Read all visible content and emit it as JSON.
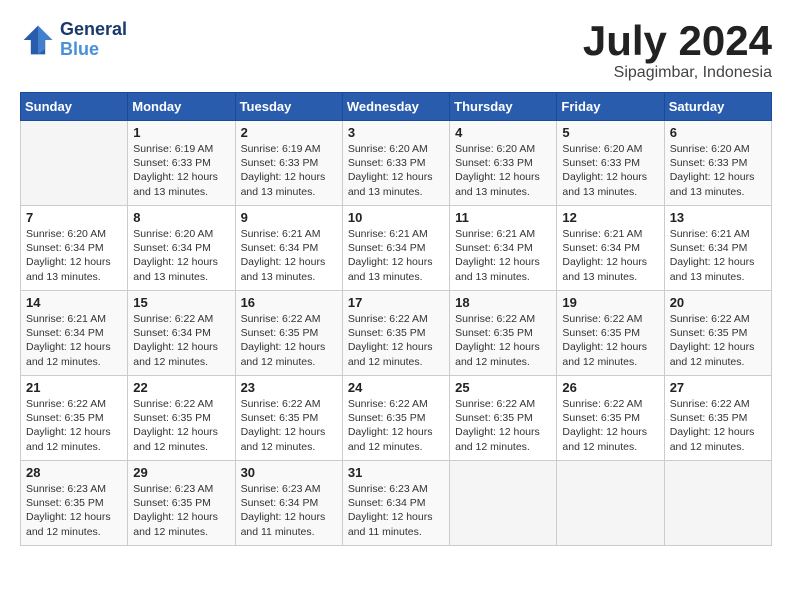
{
  "header": {
    "logo_line1": "General",
    "logo_line2": "Blue",
    "month_year": "July 2024",
    "location": "Sipagimbar, Indonesia"
  },
  "weekdays": [
    "Sunday",
    "Monday",
    "Tuesday",
    "Wednesday",
    "Thursday",
    "Friday",
    "Saturday"
  ],
  "weeks": [
    [
      {
        "day": "",
        "info": ""
      },
      {
        "day": "1",
        "info": "Sunrise: 6:19 AM\nSunset: 6:33 PM\nDaylight: 12 hours\nand 13 minutes."
      },
      {
        "day": "2",
        "info": "Sunrise: 6:19 AM\nSunset: 6:33 PM\nDaylight: 12 hours\nand 13 minutes."
      },
      {
        "day": "3",
        "info": "Sunrise: 6:20 AM\nSunset: 6:33 PM\nDaylight: 12 hours\nand 13 minutes."
      },
      {
        "day": "4",
        "info": "Sunrise: 6:20 AM\nSunset: 6:33 PM\nDaylight: 12 hours\nand 13 minutes."
      },
      {
        "day": "5",
        "info": "Sunrise: 6:20 AM\nSunset: 6:33 PM\nDaylight: 12 hours\nand 13 minutes."
      },
      {
        "day": "6",
        "info": "Sunrise: 6:20 AM\nSunset: 6:33 PM\nDaylight: 12 hours\nand 13 minutes."
      }
    ],
    [
      {
        "day": "7",
        "info": "Sunrise: 6:20 AM\nSunset: 6:34 PM\nDaylight: 12 hours\nand 13 minutes."
      },
      {
        "day": "8",
        "info": "Sunrise: 6:20 AM\nSunset: 6:34 PM\nDaylight: 12 hours\nand 13 minutes."
      },
      {
        "day": "9",
        "info": "Sunrise: 6:21 AM\nSunset: 6:34 PM\nDaylight: 12 hours\nand 13 minutes."
      },
      {
        "day": "10",
        "info": "Sunrise: 6:21 AM\nSunset: 6:34 PM\nDaylight: 12 hours\nand 13 minutes."
      },
      {
        "day": "11",
        "info": "Sunrise: 6:21 AM\nSunset: 6:34 PM\nDaylight: 12 hours\nand 13 minutes."
      },
      {
        "day": "12",
        "info": "Sunrise: 6:21 AM\nSunset: 6:34 PM\nDaylight: 12 hours\nand 13 minutes."
      },
      {
        "day": "13",
        "info": "Sunrise: 6:21 AM\nSunset: 6:34 PM\nDaylight: 12 hours\nand 13 minutes."
      }
    ],
    [
      {
        "day": "14",
        "info": "Sunrise: 6:21 AM\nSunset: 6:34 PM\nDaylight: 12 hours\nand 12 minutes."
      },
      {
        "day": "15",
        "info": "Sunrise: 6:22 AM\nSunset: 6:34 PM\nDaylight: 12 hours\nand 12 minutes."
      },
      {
        "day": "16",
        "info": "Sunrise: 6:22 AM\nSunset: 6:35 PM\nDaylight: 12 hours\nand 12 minutes."
      },
      {
        "day": "17",
        "info": "Sunrise: 6:22 AM\nSunset: 6:35 PM\nDaylight: 12 hours\nand 12 minutes."
      },
      {
        "day": "18",
        "info": "Sunrise: 6:22 AM\nSunset: 6:35 PM\nDaylight: 12 hours\nand 12 minutes."
      },
      {
        "day": "19",
        "info": "Sunrise: 6:22 AM\nSunset: 6:35 PM\nDaylight: 12 hours\nand 12 minutes."
      },
      {
        "day": "20",
        "info": "Sunrise: 6:22 AM\nSunset: 6:35 PM\nDaylight: 12 hours\nand 12 minutes."
      }
    ],
    [
      {
        "day": "21",
        "info": "Sunrise: 6:22 AM\nSunset: 6:35 PM\nDaylight: 12 hours\nand 12 minutes."
      },
      {
        "day": "22",
        "info": "Sunrise: 6:22 AM\nSunset: 6:35 PM\nDaylight: 12 hours\nand 12 minutes."
      },
      {
        "day": "23",
        "info": "Sunrise: 6:22 AM\nSunset: 6:35 PM\nDaylight: 12 hours\nand 12 minutes."
      },
      {
        "day": "24",
        "info": "Sunrise: 6:22 AM\nSunset: 6:35 PM\nDaylight: 12 hours\nand 12 minutes."
      },
      {
        "day": "25",
        "info": "Sunrise: 6:22 AM\nSunset: 6:35 PM\nDaylight: 12 hours\nand 12 minutes."
      },
      {
        "day": "26",
        "info": "Sunrise: 6:22 AM\nSunset: 6:35 PM\nDaylight: 12 hours\nand 12 minutes."
      },
      {
        "day": "27",
        "info": "Sunrise: 6:22 AM\nSunset: 6:35 PM\nDaylight: 12 hours\nand 12 minutes."
      }
    ],
    [
      {
        "day": "28",
        "info": "Sunrise: 6:23 AM\nSunset: 6:35 PM\nDaylight: 12 hours\nand 12 minutes."
      },
      {
        "day": "29",
        "info": "Sunrise: 6:23 AM\nSunset: 6:35 PM\nDaylight: 12 hours\nand 12 minutes."
      },
      {
        "day": "30",
        "info": "Sunrise: 6:23 AM\nSunset: 6:34 PM\nDaylight: 12 hours\nand 11 minutes."
      },
      {
        "day": "31",
        "info": "Sunrise: 6:23 AM\nSunset: 6:34 PM\nDaylight: 12 hours\nand 11 minutes."
      },
      {
        "day": "",
        "info": ""
      },
      {
        "day": "",
        "info": ""
      },
      {
        "day": "",
        "info": ""
      }
    ]
  ]
}
